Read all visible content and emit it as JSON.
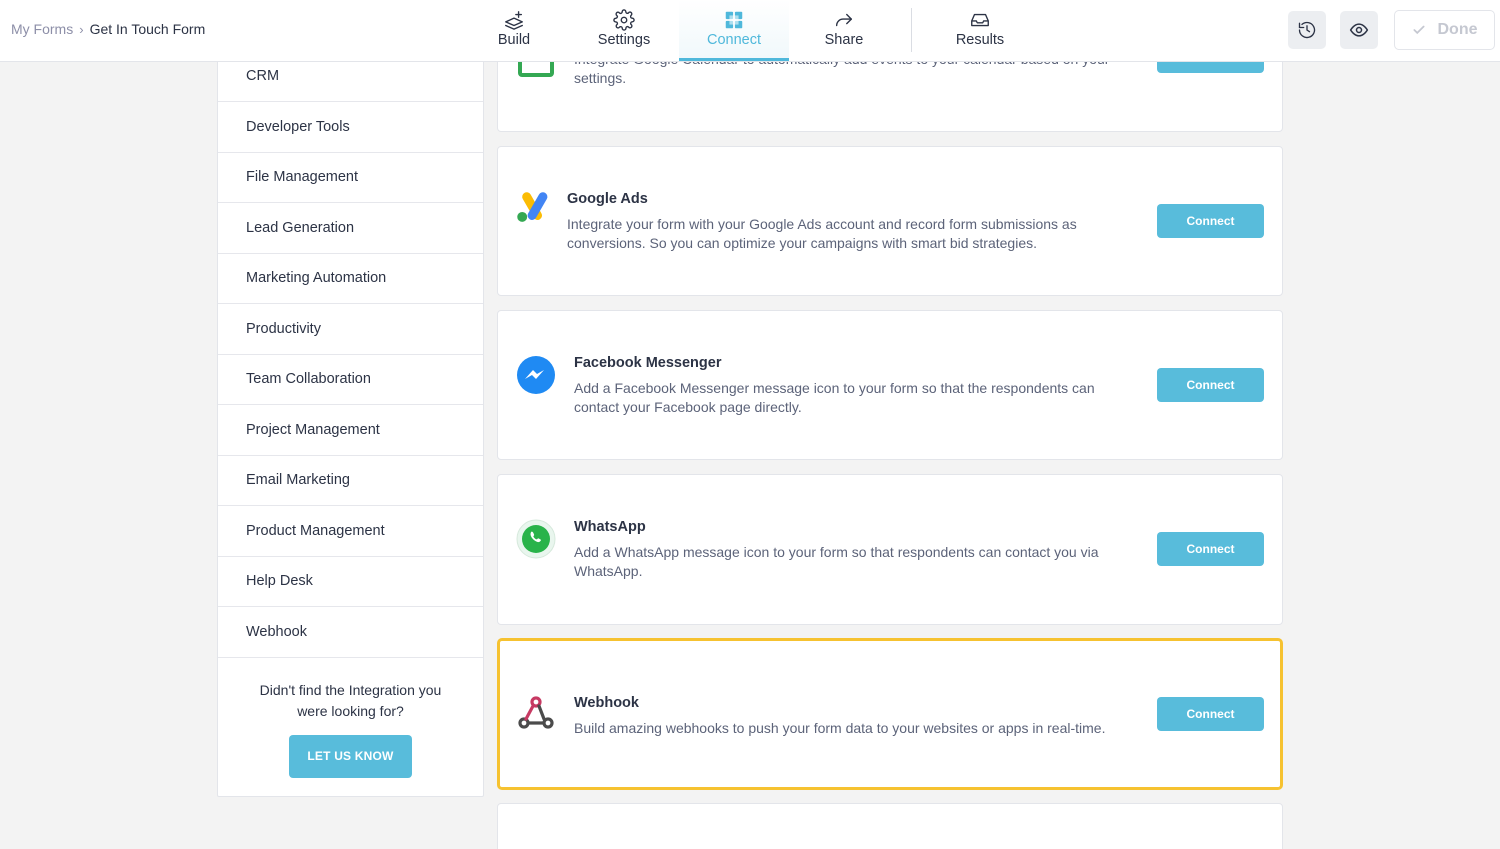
{
  "breadcrumb": {
    "root": "My Forms",
    "separator": "›",
    "current": "Get In Touch Form"
  },
  "nav": {
    "build": "Build",
    "settings": "Settings",
    "connect": "Connect",
    "share": "Share",
    "results": "Results"
  },
  "toolbar": {
    "done": "Done"
  },
  "sidebar": {
    "items": [
      {
        "label": "CRM"
      },
      {
        "label": "Developer Tools"
      },
      {
        "label": "File Management"
      },
      {
        "label": "Lead Generation"
      },
      {
        "label": "Marketing Automation"
      },
      {
        "label": "Productivity"
      },
      {
        "label": "Team Collaboration"
      },
      {
        "label": "Project Management"
      },
      {
        "label": "Email Marketing"
      },
      {
        "label": "Product Management"
      },
      {
        "label": "Help Desk"
      },
      {
        "label": "Webhook"
      }
    ],
    "help_text": "Didn't find the Integration you were looking for?",
    "help_button": "LET US KNOW"
  },
  "integrations": [
    {
      "title": "",
      "desc": "Integrate Google Calendar to automatically add events to your calendar based on your settings.",
      "button": "Connect"
    },
    {
      "title": "Google Ads",
      "desc": "Integrate your form with your Google Ads account and record form submissions as conversions. So you can optimize your campaigns with smart bid strategies.",
      "button": "Connect"
    },
    {
      "title": "Facebook Messenger",
      "desc": "Add a Facebook Messenger message icon to your form so that the respondents can contact your Facebook page directly.",
      "button": "Connect"
    },
    {
      "title": "WhatsApp",
      "desc": "Add a WhatsApp message icon to your form so that respondents can contact you via WhatsApp.",
      "button": "Connect"
    },
    {
      "title": "Webhook",
      "desc": "Build amazing webhooks to push your form data to your websites or apps in real-time.",
      "button": "Connect"
    }
  ],
  "colors": {
    "accent": "#58bcdb",
    "highlight": "#f6c230",
    "active_nav": "#4fb8db"
  }
}
